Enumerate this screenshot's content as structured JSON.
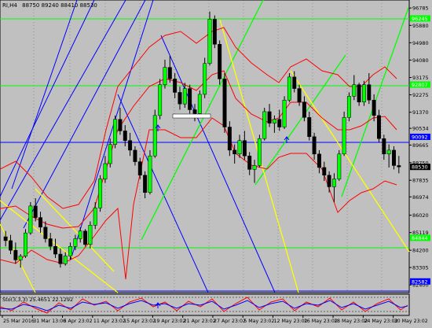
{
  "header": {
    "symbol_timeframe": "RI,H4",
    "ohlc": "88750 89240 88410 88530"
  },
  "indicator": {
    "label": "Sto(3,3,3) 25.4651 22.1292"
  },
  "colors": {
    "background": "#c0c0c0",
    "bull_candle": "#00ff00",
    "bear_candle": "#000000",
    "bollinger": "#ff0000",
    "horizontal_green": "#00ff00",
    "horizontal_blue": "#0000ff",
    "trend_yellow": "#ffff00",
    "trend_blue": "#0000ff",
    "trend_green": "#00ff00",
    "stoch_main": "#ff0000",
    "stoch_signal": "#0000ff"
  },
  "chart_data": {
    "type": "candlestick",
    "ylim": [
      82000,
      97200
    ],
    "price_axis_ticks": [
      "96785",
      "95880",
      "94980",
      "94080",
      "93175",
      "92275",
      "91370",
      "90534",
      "89665",
      "88750",
      "87835",
      "86974",
      "86020",
      "85119",
      "84200",
      "83305",
      "82400"
    ],
    "highlighted_levels": [
      {
        "label": "96245",
        "value": 96245,
        "color": "#00ff00"
      },
      {
        "label": "92807",
        "value": 92807,
        "color": "#00ff00"
      },
      {
        "label": "90092",
        "value": 90092,
        "color": "#0000ff"
      },
      {
        "label": "88530",
        "value": 88530,
        "color": "#000000"
      },
      {
        "label": "84844",
        "value": 84844,
        "color": "#00ff00"
      },
      {
        "label": "82582",
        "value": 82582,
        "color": "#0000ff"
      }
    ],
    "time_axis_ticks": [
      "25 Mar 2016",
      "31 Mar 13:00",
      "6 Apr 23:02",
      "11 Apr 23:02",
      "15 Apr 23:02",
      "19 Apr 23:02",
      "21 Apr 23:02",
      "27 Apr 23:02",
      "5 May 23:02",
      "12 May 23:02",
      "16 May 23:02",
      "18 May 23:02",
      "24 May 23:02",
      "30 May 23:02"
    ],
    "candles": [
      [
        84900,
        85200,
        84400,
        84700
      ],
      [
        84700,
        85000,
        84000,
        84200
      ],
      [
        84200,
        84600,
        83500,
        83700
      ],
      [
        83700,
        84000,
        83300,
        83900
      ],
      [
        83900,
        85300,
        83800,
        85100
      ],
      [
        85100,
        86700,
        85000,
        86500
      ],
      [
        86500,
        86900,
        85700,
        85900
      ],
      [
        85900,
        86200,
        85100,
        85400
      ],
      [
        85400,
        85700,
        84600,
        84800
      ],
      [
        84800,
        85100,
        84200,
        84400
      ],
      [
        84400,
        84800,
        83800,
        84000
      ],
      [
        84000,
        84300,
        83300,
        83500
      ],
      [
        83500,
        84100,
        83400,
        83900
      ],
      [
        83900,
        84600,
        83700,
        84400
      ],
      [
        84400,
        85000,
        84200,
        84800
      ],
      [
        84800,
        85400,
        84600,
        85200
      ],
      [
        85200,
        85300,
        84400,
        84500
      ],
      [
        84500,
        85700,
        84300,
        85500
      ],
      [
        85500,
        86700,
        85300,
        86400
      ],
      [
        86400,
        88100,
        86200,
        87900
      ],
      [
        87900,
        89100,
        87700,
        88700
      ],
      [
        88700,
        90000,
        88500,
        89700
      ],
      [
        89700,
        91200,
        89500,
        91000
      ],
      [
        91000,
        91600,
        90200,
        90400
      ],
      [
        90400,
        90700,
        89600,
        89900
      ],
      [
        89900,
        90300,
        89100,
        89400
      ],
      [
        89400,
        89600,
        88600,
        88800
      ],
      [
        88800,
        89000,
        87900,
        88100
      ],
      [
        88100,
        88300,
        86900,
        87200
      ],
      [
        87200,
        89400,
        87100,
        89100
      ],
      [
        89100,
        91500,
        89000,
        91200
      ],
      [
        91200,
        93100,
        91000,
        92800
      ],
      [
        92800,
        94100,
        92600,
        93700
      ],
      [
        93700,
        94300,
        92900,
        93100
      ],
      [
        93100,
        93400,
        92100,
        92400
      ],
      [
        92400,
        92700,
        91500,
        91800
      ],
      [
        91800,
        92900,
        91600,
        92600
      ],
      [
        92600,
        92800,
        91300,
        91500
      ],
      [
        91500,
        91800,
        90900,
        91300
      ],
      [
        91300,
        92500,
        91200,
        92300
      ],
      [
        92300,
        94200,
        92100,
        93900
      ],
      [
        93900,
        96600,
        93800,
        96200
      ],
      [
        96200,
        96400,
        94700,
        94900
      ],
      [
        94900,
        95100,
        92800,
        93100
      ],
      [
        93100,
        93400,
        90300,
        90600
      ],
      [
        90600,
        90900,
        89100,
        89400
      ],
      [
        89400,
        89700,
        88700,
        89200
      ],
      [
        89200,
        90200,
        89000,
        89900
      ],
      [
        89900,
        90400,
        88900,
        89100
      ],
      [
        89100,
        89300,
        88100,
        88400
      ],
      [
        88400,
        88900,
        87700,
        88600
      ],
      [
        88600,
        90200,
        88500,
        90000
      ],
      [
        90000,
        91600,
        89900,
        91400
      ],
      [
        91400,
        91800,
        90600,
        90800
      ],
      [
        90800,
        91200,
        90300,
        91000
      ],
      [
        91000,
        91500,
        90400,
        90600
      ],
      [
        90600,
        92200,
        90500,
        92000
      ],
      [
        92000,
        93400,
        91900,
        93200
      ],
      [
        93200,
        93500,
        92400,
        92600
      ],
      [
        92600,
        92800,
        91700,
        91900
      ],
      [
        91900,
        92200,
        90900,
        91100
      ],
      [
        91100,
        91400,
        89900,
        90100
      ],
      [
        90100,
        90300,
        88900,
        89200
      ],
      [
        89200,
        89400,
        88200,
        88500
      ],
      [
        88500,
        88800,
        87800,
        88100
      ],
      [
        88100,
        88300,
        87200,
        87500
      ],
      [
        87500,
        88200,
        86700,
        87900
      ],
      [
        87900,
        89400,
        87800,
        89200
      ],
      [
        89200,
        91400,
        89100,
        91100
      ],
      [
        91100,
        92400,
        90900,
        92200
      ],
      [
        92200,
        93300,
        92000,
        92800
      ],
      [
        92800,
        92900,
        91700,
        91900
      ],
      [
        91900,
        93000,
        91700,
        92800
      ],
      [
        92800,
        93400,
        91800,
        92000
      ],
      [
        92000,
        92300,
        90900,
        91200
      ],
      [
        91200,
        91500,
        89800,
        90000
      ],
      [
        90000,
        90200,
        88900,
        89200
      ],
      [
        89200,
        89700,
        88500,
        89400
      ],
      [
        89400,
        89600,
        88400,
        88600
      ],
      [
        88600,
        89100,
        88200,
        88530
      ]
    ]
  }
}
